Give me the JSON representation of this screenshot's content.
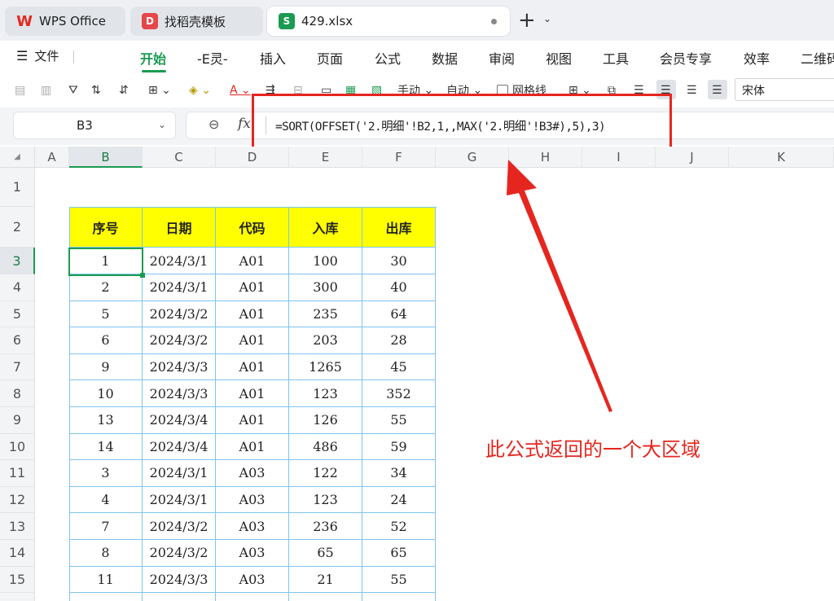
{
  "tabs": [
    {
      "label": "WPS Office",
      "icon": "wps-logo-icon"
    },
    {
      "label": "找稻壳模板",
      "icon": "docer-icon"
    },
    {
      "label": "429.xlsx",
      "icon": "spreadsheet-icon",
      "icon_letter": "S"
    }
  ],
  "menu": {
    "file_label": "文件",
    "items": [
      "开始",
      "-E灵-",
      "插入",
      "页面",
      "公式",
      "数据",
      "审阅",
      "视图",
      "工具",
      "会员专享",
      "效率",
      "二维码"
    ],
    "active": "开始"
  },
  "toolbar": {
    "manual_label": "手动",
    "auto_label": "自动",
    "gridlines_label": "网格线",
    "font_name": "宋体"
  },
  "formula_bar": {
    "cell_ref": "B3",
    "fx_label": "fx",
    "formula": "=SORT(OFFSET('2.明细'!B2,1,,MAX('2.明细'!B3#),5),3)"
  },
  "columns": [
    "A",
    "B",
    "C",
    "D",
    "E",
    "F",
    "G",
    "H",
    "I",
    "J",
    "K"
  ],
  "rows": [
    "1",
    "2",
    "3",
    "4",
    "5",
    "6",
    "7",
    "8",
    "9",
    "10",
    "11",
    "12",
    "13",
    "14",
    "15"
  ],
  "table": {
    "headers": [
      "序号",
      "日期",
      "代码",
      "入库",
      "出库"
    ],
    "data": [
      [
        "1",
        "2024/3/1",
        "A01",
        "100",
        "30"
      ],
      [
        "2",
        "2024/3/1",
        "A01",
        "300",
        "40"
      ],
      [
        "5",
        "2024/3/2",
        "A01",
        "235",
        "64"
      ],
      [
        "6",
        "2024/3/2",
        "A01",
        "203",
        "28"
      ],
      [
        "9",
        "2024/3/3",
        "A01",
        "1265",
        "45"
      ],
      [
        "10",
        "2024/3/3",
        "A01",
        "123",
        "352"
      ],
      [
        "13",
        "2024/3/4",
        "A01",
        "126",
        "55"
      ],
      [
        "14",
        "2024/3/4",
        "A01",
        "486",
        "59"
      ],
      [
        "3",
        "2024/3/1",
        "A03",
        "122",
        "34"
      ],
      [
        "4",
        "2024/3/1",
        "A03",
        "123",
        "24"
      ],
      [
        "7",
        "2024/3/2",
        "A03",
        "236",
        "52"
      ],
      [
        "8",
        "2024/3/2",
        "A03",
        "65",
        "65"
      ],
      [
        "11",
        "2024/3/3",
        "A03",
        "21",
        "55"
      ]
    ]
  },
  "annotation": "此公式返回的一个大区域",
  "colors": {
    "accent": "#1b9b52",
    "header_fill": "#ffff00",
    "annotation": "#e5261f",
    "cell_border": "#7fc4f0"
  }
}
